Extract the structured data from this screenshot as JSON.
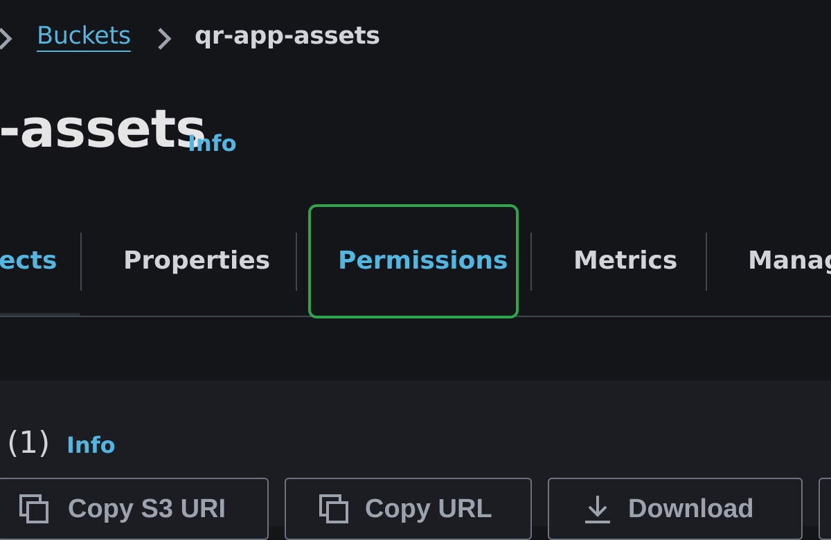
{
  "breadcrumb": {
    "link": "Buckets",
    "current": "qr-app-assets"
  },
  "header": {
    "title": "-assets",
    "info": "Info"
  },
  "tabs": [
    {
      "label": "ects",
      "state": "partial"
    },
    {
      "label": "Properties",
      "state": "inactive"
    },
    {
      "label": "Permissions",
      "state": "active"
    },
    {
      "label": "Metrics",
      "state": "inactive"
    },
    {
      "label": "Manag",
      "state": "partial"
    }
  ],
  "section": {
    "count": "(1)",
    "info": "Info"
  },
  "actions": {
    "copy_s3_uri": "Copy S3 URI",
    "copy_url": "Copy URL",
    "download": "Download"
  },
  "colors": {
    "link": "#52b6e0",
    "highlight": "#2ea44f",
    "background": "#141518"
  },
  "icons": {
    "breadcrumb_separator": "chevron-right-icon",
    "copy": "copy-icon",
    "download": "download-icon"
  }
}
